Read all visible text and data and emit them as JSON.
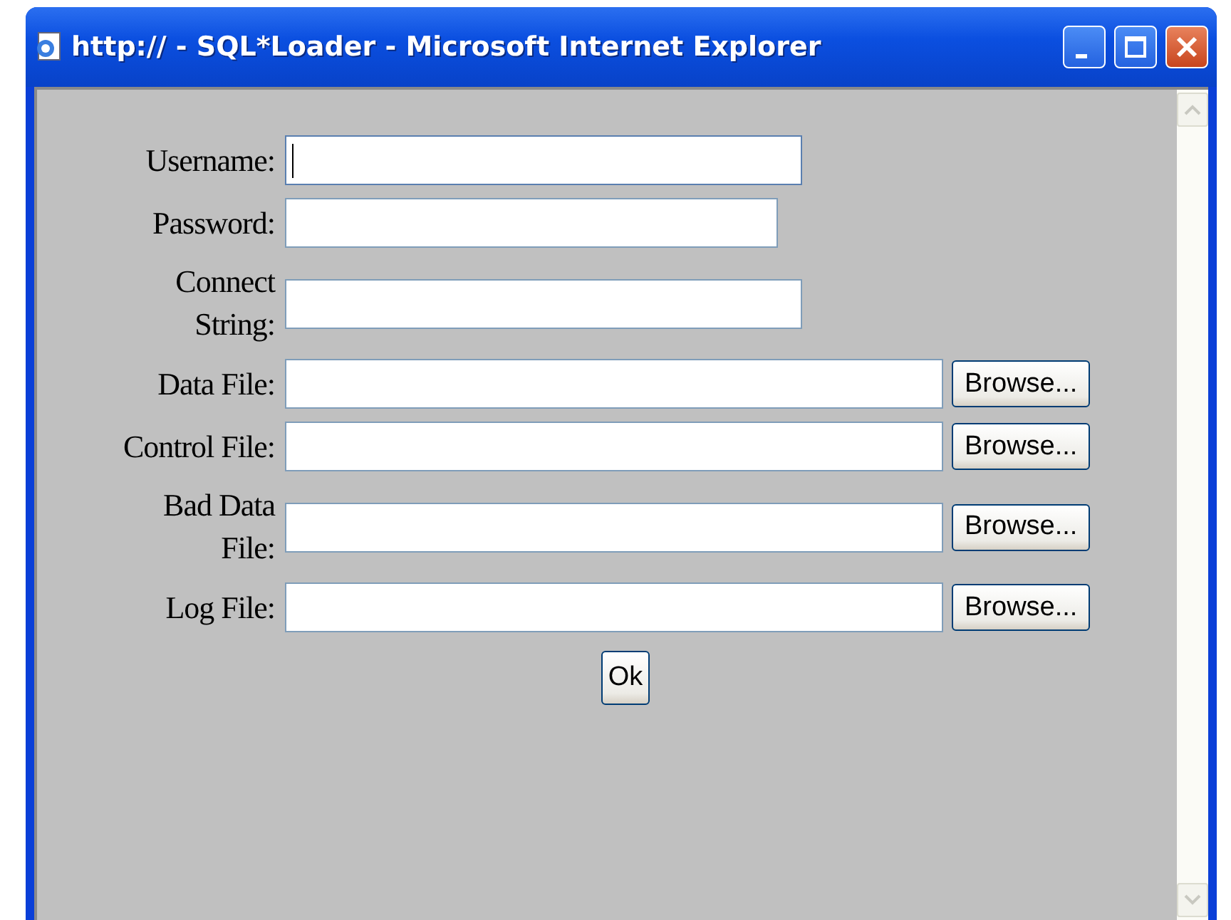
{
  "window": {
    "title": "http:// - SQL*Loader - Microsoft Internet Explorer"
  },
  "fields": [
    {
      "label": "Username:",
      "kind": "text",
      "focused": true
    },
    {
      "label": "Password:",
      "kind": "password",
      "focused": false
    },
    {
      "label": "Connect String:",
      "kind": "text",
      "focused": false
    },
    {
      "label": "Data File:",
      "kind": "file",
      "focused": false,
      "button": "Browse..."
    },
    {
      "label": "Control File:",
      "kind": "file",
      "focused": false,
      "button": "Browse..."
    },
    {
      "label": "Bad Data File:",
      "kind": "file",
      "focused": false,
      "button": "Browse..."
    },
    {
      "label": "Log File:",
      "kind": "file",
      "focused": false,
      "button": "Browse..."
    }
  ],
  "submit": "Ok"
}
